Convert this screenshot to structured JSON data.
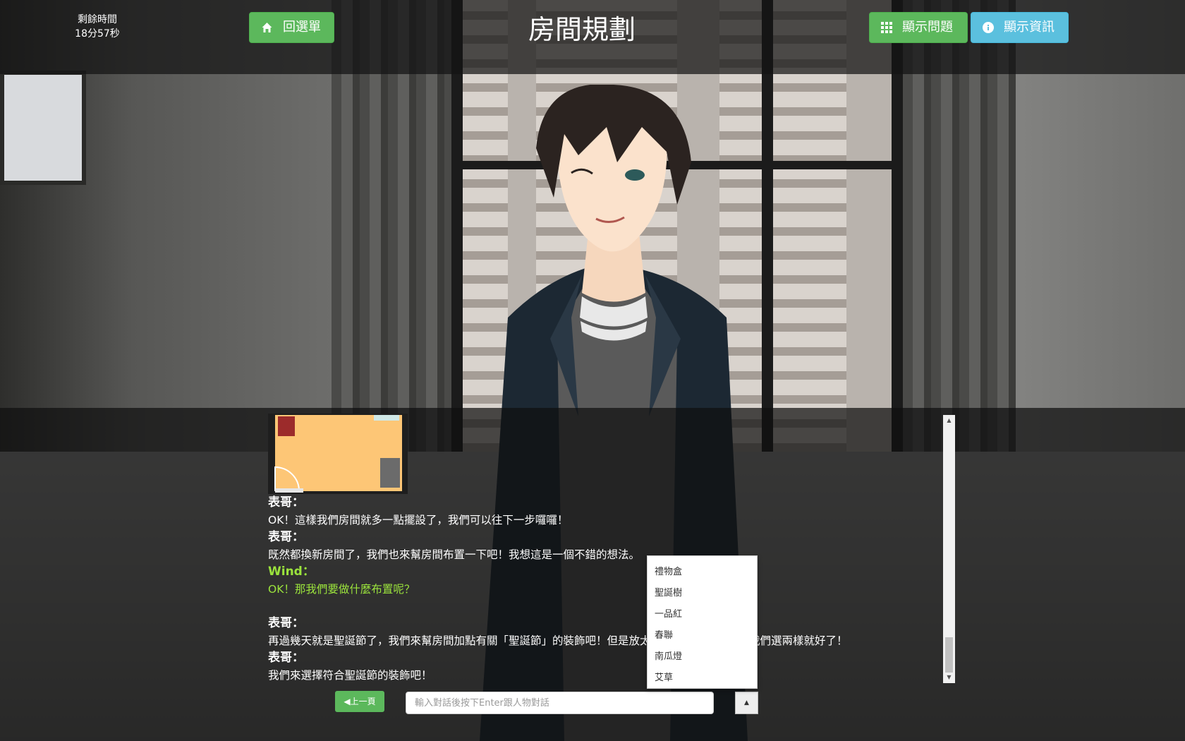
{
  "timer": {
    "label": "剩餘時間",
    "value": "18分57秒"
  },
  "header": {
    "back_label": "回選單",
    "title": "房間規劃",
    "show_question_label": "顯示問題",
    "show_info_label": "顯示資訊"
  },
  "dialog": {
    "lines": [
      {
        "speaker": "表哥：",
        "text": "OK！這樣我們房間就多一點擺設了，我們可以往下一步囉囉！"
      },
      {
        "speaker": "表哥：",
        "text": "既然都換新房間了，我們也來幫房間布置一下吧！我想這是一個不錯的想法。"
      },
      {
        "speaker": "Wind：",
        "text": "OK！那我們要做什麼布置呢？"
      },
      {
        "speaker": "表哥：",
        "text": "再過幾天就是聖誕節了，我們來幫房間加點有關「聖誕節」的裝飾吧！但是放太多東西又會佔空間，我們選兩樣就好了！"
      },
      {
        "speaker": "表哥：",
        "text": "我們來選擇符合聖誕節的裝飾吧！"
      }
    ]
  },
  "controls": {
    "prev_label": "◀上一頁",
    "input_placeholder": "輸入對話後按下Enter跟人物對話",
    "dropdown_options": [
      "禮物盒",
      "聖誕樹",
      "一品紅",
      "春聯",
      "南瓜燈",
      "艾草"
    ]
  },
  "colors": {
    "green": "#5cb85c",
    "blue": "#5bc0de",
    "player_text": "#9be33c",
    "floor_plan": "#fdc676"
  }
}
